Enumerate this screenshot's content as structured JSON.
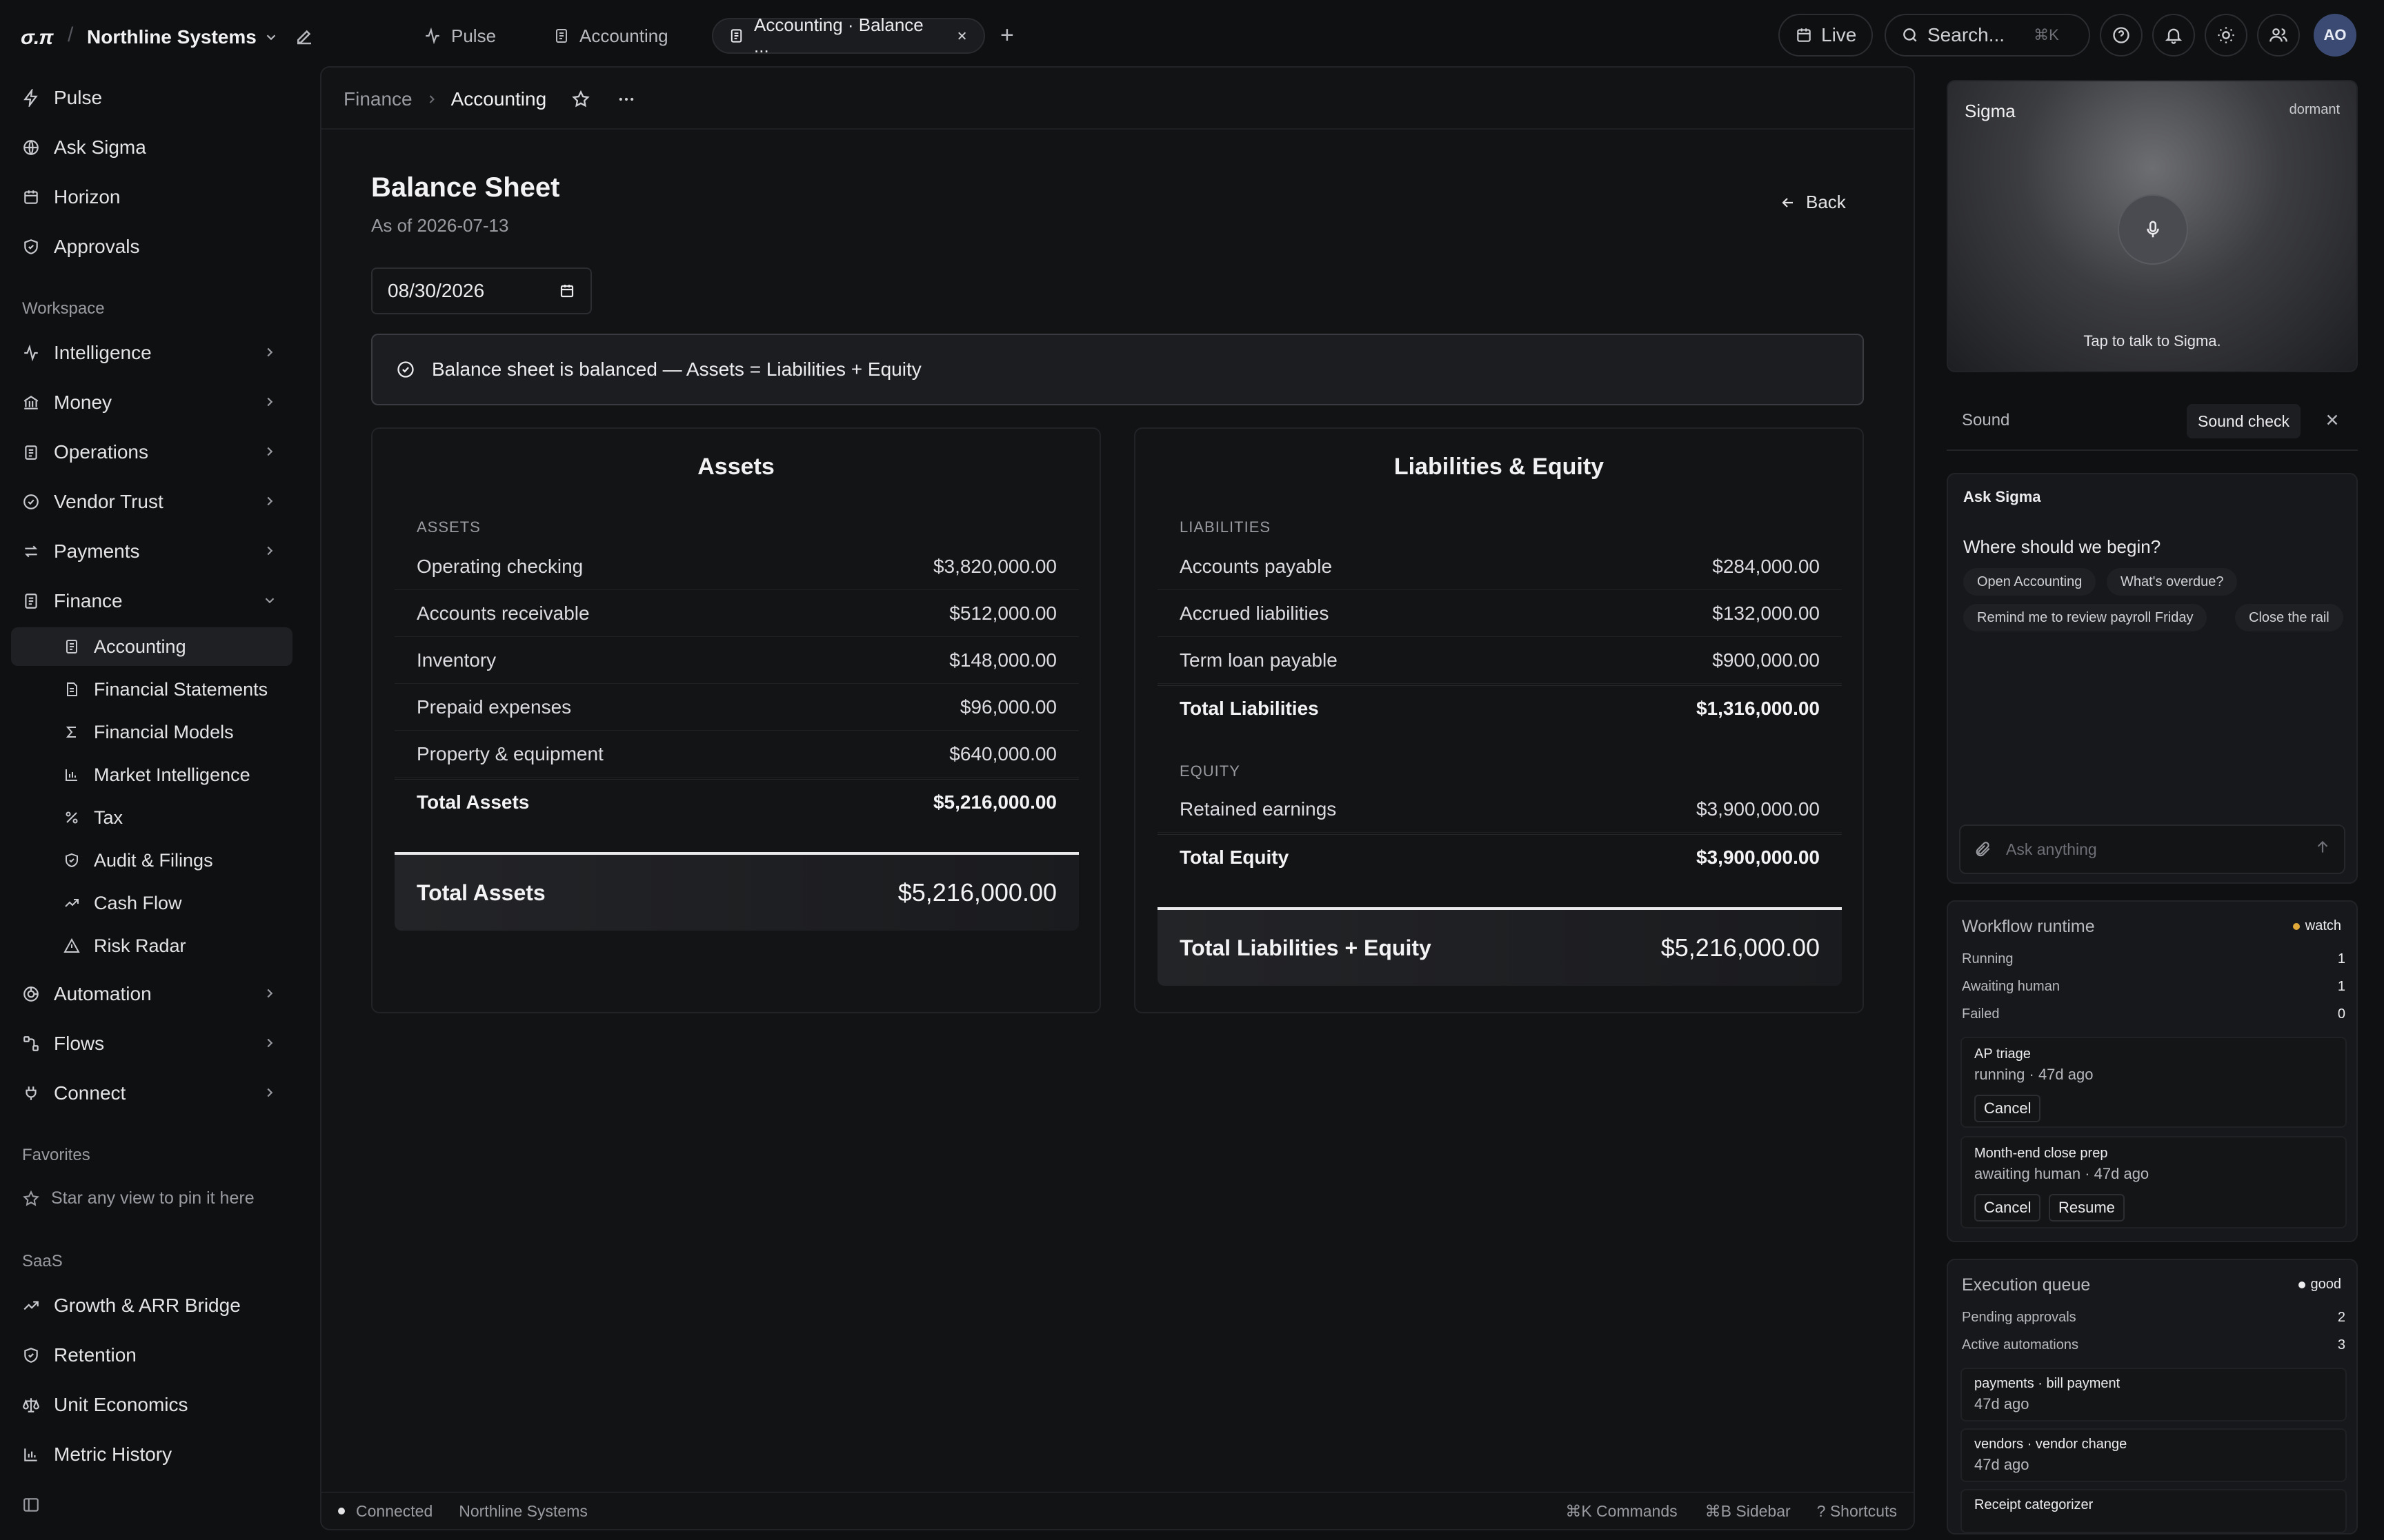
{
  "app": {
    "logo": "σ.π",
    "org": "Northline Systems"
  },
  "tabs": [
    {
      "label": "Pulse"
    },
    {
      "label": "Accounting"
    },
    {
      "label": "Accounting · Balance ..."
    }
  ],
  "topbar": {
    "live": "Live",
    "search_placeholder": "Search...",
    "search_kbd": "⌘K",
    "avatar": "AO"
  },
  "sidebar": {
    "top": [
      "Pulse",
      "Ask Sigma",
      "Horizon",
      "Approvals"
    ],
    "workspace_label": "Workspace",
    "workspace": [
      "Intelligence",
      "Money",
      "Operations",
      "Vendor Trust",
      "Payments",
      "Finance"
    ],
    "finance_children": [
      "Accounting",
      "Financial Statements",
      "Financial Models",
      "Market Intelligence",
      "Tax",
      "Audit & Filings",
      "Cash Flow",
      "Risk Radar"
    ],
    "more": [
      "Automation",
      "Flows",
      "Connect"
    ],
    "favorites_label": "Favorites",
    "favorites_empty": "Star any view to pin it here",
    "saas_label": "SaaS",
    "saas": [
      "Growth & ARR Bridge",
      "Retention",
      "Unit Economics",
      "Metric History"
    ]
  },
  "breadcrumb": {
    "parent": "Finance",
    "current": "Accounting"
  },
  "page": {
    "title": "Balance Sheet",
    "subtitle": "As of 2026-07-13",
    "back": "Back",
    "date_value": "08/30/2026",
    "banner": "Balance sheet is balanced — Assets = Liabilities + Equity"
  },
  "assets": {
    "title": "Assets",
    "section": "ASSETS",
    "rows": [
      {
        "label": "Operating checking",
        "value": "$3,820,000.00"
      },
      {
        "label": "Accounts receivable",
        "value": "$512,000.00"
      },
      {
        "label": "Inventory",
        "value": "$148,000.00"
      },
      {
        "label": "Prepaid expenses",
        "value": "$96,000.00"
      },
      {
        "label": "Property & equipment",
        "value": "$640,000.00"
      }
    ],
    "total_label": "Total Assets",
    "total_value": "$5,216,000.00",
    "grand_label": "Total Assets",
    "grand_value": "$5,216,000.00"
  },
  "liabilities_equity": {
    "title": "Liabilities & Equity",
    "liab_section": "LIABILITIES",
    "liab_rows": [
      {
        "label": "Accounts payable",
        "value": "$284,000.00"
      },
      {
        "label": "Accrued liabilities",
        "value": "$132,000.00"
      },
      {
        "label": "Term loan payable",
        "value": "$900,000.00"
      }
    ],
    "liab_total_label": "Total Liabilities",
    "liab_total_value": "$1,316,000.00",
    "eq_section": "EQUITY",
    "eq_rows": [
      {
        "label": "Retained earnings",
        "value": "$3,900,000.00"
      }
    ],
    "eq_total_label": "Total Equity",
    "eq_total_value": "$3,900,000.00",
    "grand_label": "Total Liabilities + Equity",
    "grand_value": "$5,216,000.00"
  },
  "statusbar": {
    "connection": "Connected",
    "org": "Northline Systems",
    "commands": "⌘K Commands",
    "sidebar": "⌘B Sidebar",
    "shortcuts": "? Shortcuts"
  },
  "voice": {
    "title": "Sigma",
    "state": "dormant",
    "hint": "Tap to talk to Sigma."
  },
  "sound": {
    "label": "Sound",
    "check": "Sound check"
  },
  "ask": {
    "title": "Ask Sigma",
    "question": "Where should we begin?",
    "chips": [
      "Open Accounting",
      "What's overdue?",
      "Remind me to review payroll Friday",
      "Close the rail"
    ],
    "placeholder": "Ask anything"
  },
  "workflow": {
    "title": "Workflow runtime",
    "badge": "watch",
    "badge_color": "#e0a93a",
    "stats": [
      {
        "label": "Running",
        "value": "1"
      },
      {
        "label": "Awaiting human",
        "value": "1"
      },
      {
        "label": "Failed",
        "value": "0"
      }
    ],
    "jobs": [
      {
        "name": "AP triage",
        "status": "running · 47d ago",
        "cancel": "Cancel"
      },
      {
        "name": "Month-end close prep",
        "status": "awaiting human · 47d ago",
        "cancel": "Cancel",
        "resume": "Resume"
      }
    ]
  },
  "queue": {
    "title": "Execution queue",
    "badge": "good",
    "badge_color": "#ececef",
    "stats": [
      {
        "label": "Pending approvals",
        "value": "2"
      },
      {
        "label": "Active automations",
        "value": "3"
      }
    ],
    "items": [
      {
        "name": "payments · bill payment",
        "time": "47d ago"
      },
      {
        "name": "vendors · vendor change",
        "time": "47d ago"
      },
      {
        "name": "Receipt categorizer"
      }
    ]
  }
}
